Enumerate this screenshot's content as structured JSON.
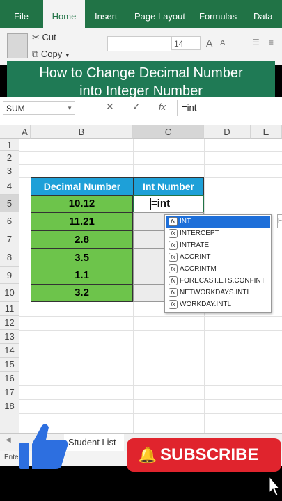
{
  "tabs": [
    "File",
    "Home",
    "Insert",
    "Page Layout",
    "Formulas",
    "Data"
  ],
  "active_tab": "Home",
  "ribbon": {
    "cut_label": "Cut",
    "copy_label": "Copy",
    "font_size": "14",
    "grow_label": "A",
    "shrink_label": "A"
  },
  "banner": {
    "line1": "How to Change Decimal Number",
    "line2": "into Integer Number"
  },
  "formula_bar": {
    "name_box": "SUM",
    "cancel": "✕",
    "enter": "✓",
    "fx": "fx",
    "formula": "=int"
  },
  "columns": [
    "A",
    "B",
    "C",
    "D",
    "E"
  ],
  "rows": [
    "1",
    "2",
    "3",
    "4",
    "5",
    "6",
    "7",
    "8",
    "9",
    "10",
    "11",
    "12",
    "13",
    "14",
    "15",
    "16",
    "17",
    "18"
  ],
  "table": {
    "header_b": "Decimal Number",
    "header_c": "Int Number",
    "values": [
      "10.12",
      "11.21",
      "2.8",
      "3.5",
      "1.1",
      "3.2"
    ],
    "active_entry": "=int"
  },
  "autocomplete": [
    "INT",
    "INTERCEPT",
    "INTRATE",
    "ACCRINT",
    "ACCRINTM",
    "FORECAST.ETS.CONFINT",
    "NETWORKDAYS.INTL",
    "WORKDAY.INTL"
  ],
  "sheet_tab": "Student List",
  "status": "Ente",
  "subscribe_label": "SUBSCRIBE",
  "colors": {
    "excel_green": "#217346",
    "header_blue": "#1ea0d8",
    "value_green": "#6dc44b",
    "subscribe_red": "#e0242d"
  }
}
